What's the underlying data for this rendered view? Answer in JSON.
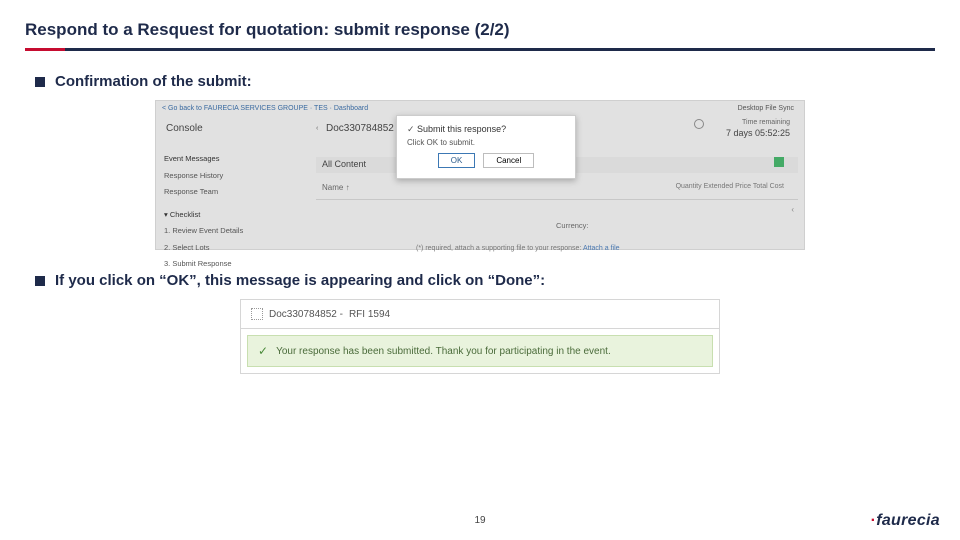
{
  "title": "Respond to a Resquest for quotation: submit response (2/2)",
  "bullets": {
    "b1": "Confirmation of the submit:",
    "b2": "If you click on “OK”, this message is appearing and click on “Done”:"
  },
  "shot1": {
    "backlink": "< Go back to FAURECIA SERVICES GROUPE · TES · Dashboard",
    "desktop_sync": "Desktop File Sync",
    "console": "Console",
    "back_glyph": "‹",
    "doc": "Doc330784852 - RFI 1594-test",
    "time_label": "Time remaining",
    "time_value": "7 days 05:52:25",
    "sidebar": {
      "event_messages": "Event Messages",
      "response_history": "Response History",
      "response_team": "Response Team",
      "checklist": "▾ Checklist",
      "c1": "1. Review Event Details",
      "c2": "2. Select Lots",
      "c3": "3. Submit Response"
    },
    "all_content": "All Content",
    "name_col": "Name ↑",
    "right_cols": "Quantity   Extended Price   Total Cost",
    "caret": "‹",
    "currency": "Currency:",
    "required": "(*) required, attach a supporting file to your response:",
    "attach": "Attach a file",
    "modal": {
      "title": "Submit this response?",
      "subtitle": "Click OK to submit.",
      "ok": "OK",
      "cancel": "Cancel"
    }
  },
  "shot2": {
    "doc": "Doc330784852 -",
    "rfi": "RFI 1594",
    "msg": "Your response has been submitted. Thank you for participating in the event."
  },
  "page_number": "19",
  "brand": {
    "dot": "·",
    "name": "faurecia"
  }
}
